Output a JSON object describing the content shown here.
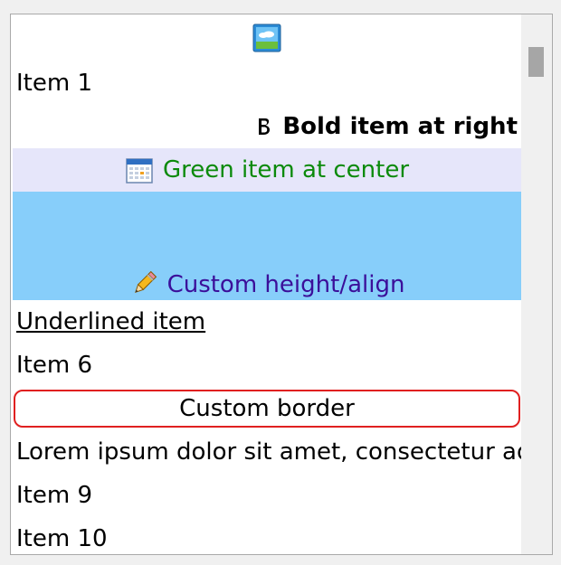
{
  "window": {
    "accent_colors": {
      "selected_light": "#e6e6fa",
      "selected_blue": "#87cefa",
      "green_text": "#0b8a0b",
      "indigo_text": "#3b0f9a",
      "border_red": "#e02020"
    }
  },
  "listbox": {
    "items": [
      {
        "label": "",
        "icon": "image-icon"
      },
      {
        "label": "Item 1"
      },
      {
        "label": "Bold item at right",
        "icon": "bold-b-icon"
      },
      {
        "label": "Green item at center",
        "icon": "calendar-icon"
      },
      {
        "label": "Custom height/align",
        "icon": "pencil-icon"
      },
      {
        "label": "Underlined item"
      },
      {
        "label": "Item 6"
      },
      {
        "label": "Custom border"
      },
      {
        "label": "Lorem ipsum dolor sit amet, consectetur adi"
      },
      {
        "label": "Item 9"
      },
      {
        "label": "Item 10"
      }
    ]
  }
}
